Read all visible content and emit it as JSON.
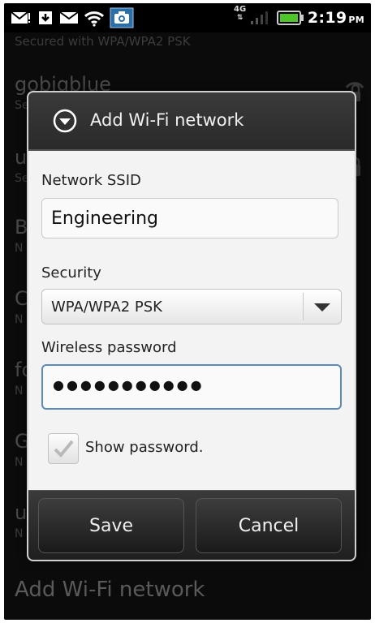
{
  "status_bar": {
    "network_badge": "4G",
    "time": "2:19",
    "ampm": "PM",
    "icons": [
      "gmail-icon",
      "download-icon",
      "email-icon",
      "wifi-icon",
      "camera-icon",
      "signal-icon",
      "battery-icon"
    ]
  },
  "background_list": {
    "items": [
      {
        "title": "",
        "subtitle": "Secured with WPA/WPA2 PSK"
      },
      {
        "title": "gobigblue",
        "subtitle": "Se"
      },
      {
        "title": "u",
        "subtitle": "Se"
      },
      {
        "title": "B",
        "subtitle": "N"
      },
      {
        "title": "C",
        "subtitle": "N"
      },
      {
        "title": "fo",
        "subtitle": "N"
      },
      {
        "title": "G",
        "subtitle": "N"
      },
      {
        "title": "u",
        "subtitle": "N"
      }
    ],
    "footer": "Add Wi-Fi network"
  },
  "dialog": {
    "title": "Add Wi-Fi network",
    "ssid_label": "Network SSID",
    "ssid_value": "Engineering",
    "security_label": "Security",
    "security_value": "WPA/WPA2 PSK",
    "password_label": "Wireless password",
    "password_value": "●●●●●●●●●●●",
    "show_password_label": "Show password.",
    "show_password_checked": true,
    "save_label": "Save",
    "cancel_label": "Cancel"
  },
  "colors": {
    "dialog_bg": "#f3f3f3",
    "header_bg": "#333333",
    "focus_border": "#5d8ab8",
    "battery_green": "#4fc52b"
  }
}
